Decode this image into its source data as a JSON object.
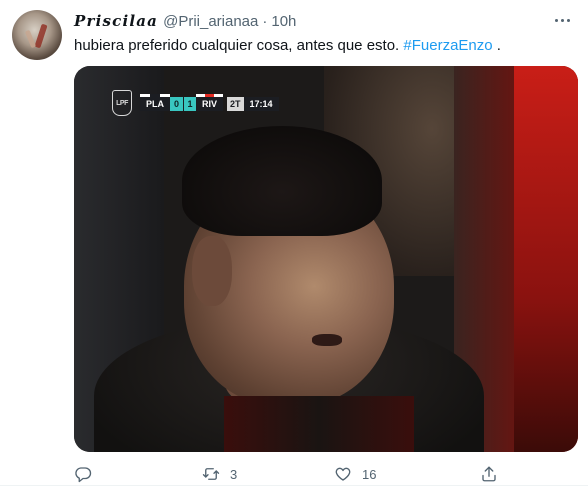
{
  "tweet": {
    "author": {
      "display_name": "𝑷𝒓𝒊𝒔𝒄𝒊𝒍𝒂𝒂",
      "handle": "@Prii_arianaa",
      "separator": "·",
      "time": "10h"
    },
    "text": "hubiera preferido cualquier cosa, antes que esto.",
    "hashtag": "#FuerzaEnzo",
    "trailing": " ."
  },
  "media": {
    "scorebug": {
      "league_logo_text": "LPF",
      "home_team": "PLA",
      "home_score": "0",
      "away_score": "1",
      "away_team": "RIV",
      "half": "2T",
      "clock": "17:14",
      "home_colors": [
        "#ffffff",
        "#1b1d22",
        "#ffffff"
      ],
      "away_colors": [
        "#ffffff",
        "#e32b23",
        "#ffffff"
      ],
      "score_color": "#39c6c0"
    }
  },
  "actions": {
    "reply": {
      "icon": "reply-icon",
      "count": ""
    },
    "retweet": {
      "icon": "retweet-icon",
      "count": "3"
    },
    "like": {
      "icon": "heart-icon",
      "count": "16"
    },
    "share": {
      "icon": "share-icon",
      "count": ""
    }
  },
  "colors": {
    "text_primary": "#0f1419",
    "text_secondary": "#536471",
    "link": "#1d9bf0"
  }
}
